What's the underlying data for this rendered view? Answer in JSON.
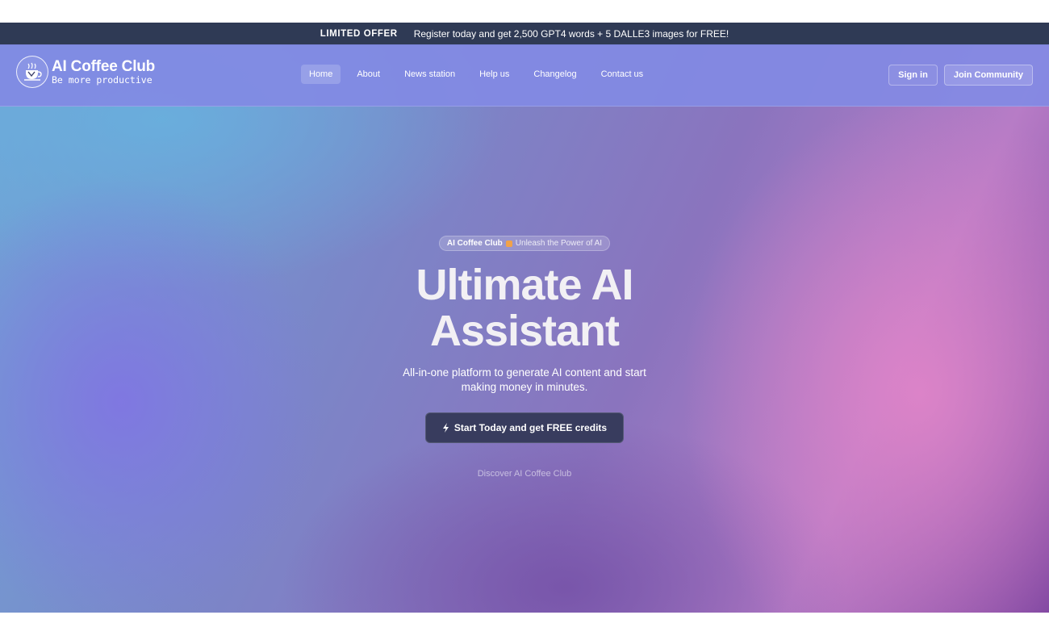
{
  "offer_bar": {
    "tag": "LIMITED OFFER",
    "message": "Register today and get 2,500 GPT4 words + 5 DALLE3 images for FREE!"
  },
  "logo": {
    "name": "AI Coffee Club",
    "tagline": "Be more productive",
    "icon": "coffee-cup-icon"
  },
  "nav": {
    "links": [
      {
        "label": "Home",
        "active": true
      },
      {
        "label": "About",
        "active": false
      },
      {
        "label": "News station",
        "active": false
      },
      {
        "label": "Help us",
        "active": false
      },
      {
        "label": "Changelog",
        "active": false
      },
      {
        "label": "Contact us",
        "active": false
      }
    ],
    "sign_in": "Sign in",
    "join": "Join Community"
  },
  "hero": {
    "pill_brand": "AI Coffee Club",
    "pill_text": "Unleash the Power of AI",
    "title_line1": "Ultimate AI",
    "title_line2": "Assistant",
    "subtitle": "All-in-one platform to generate AI content and start making money in minutes.",
    "cta": "Start Today and get FREE credits",
    "cta_icon": "lightning-icon",
    "discover": "Discover AI Coffee Club"
  },
  "colors": {
    "offer_bar": "#2f3a55",
    "navbar": "#828ae4",
    "cta": "#383c5e"
  }
}
